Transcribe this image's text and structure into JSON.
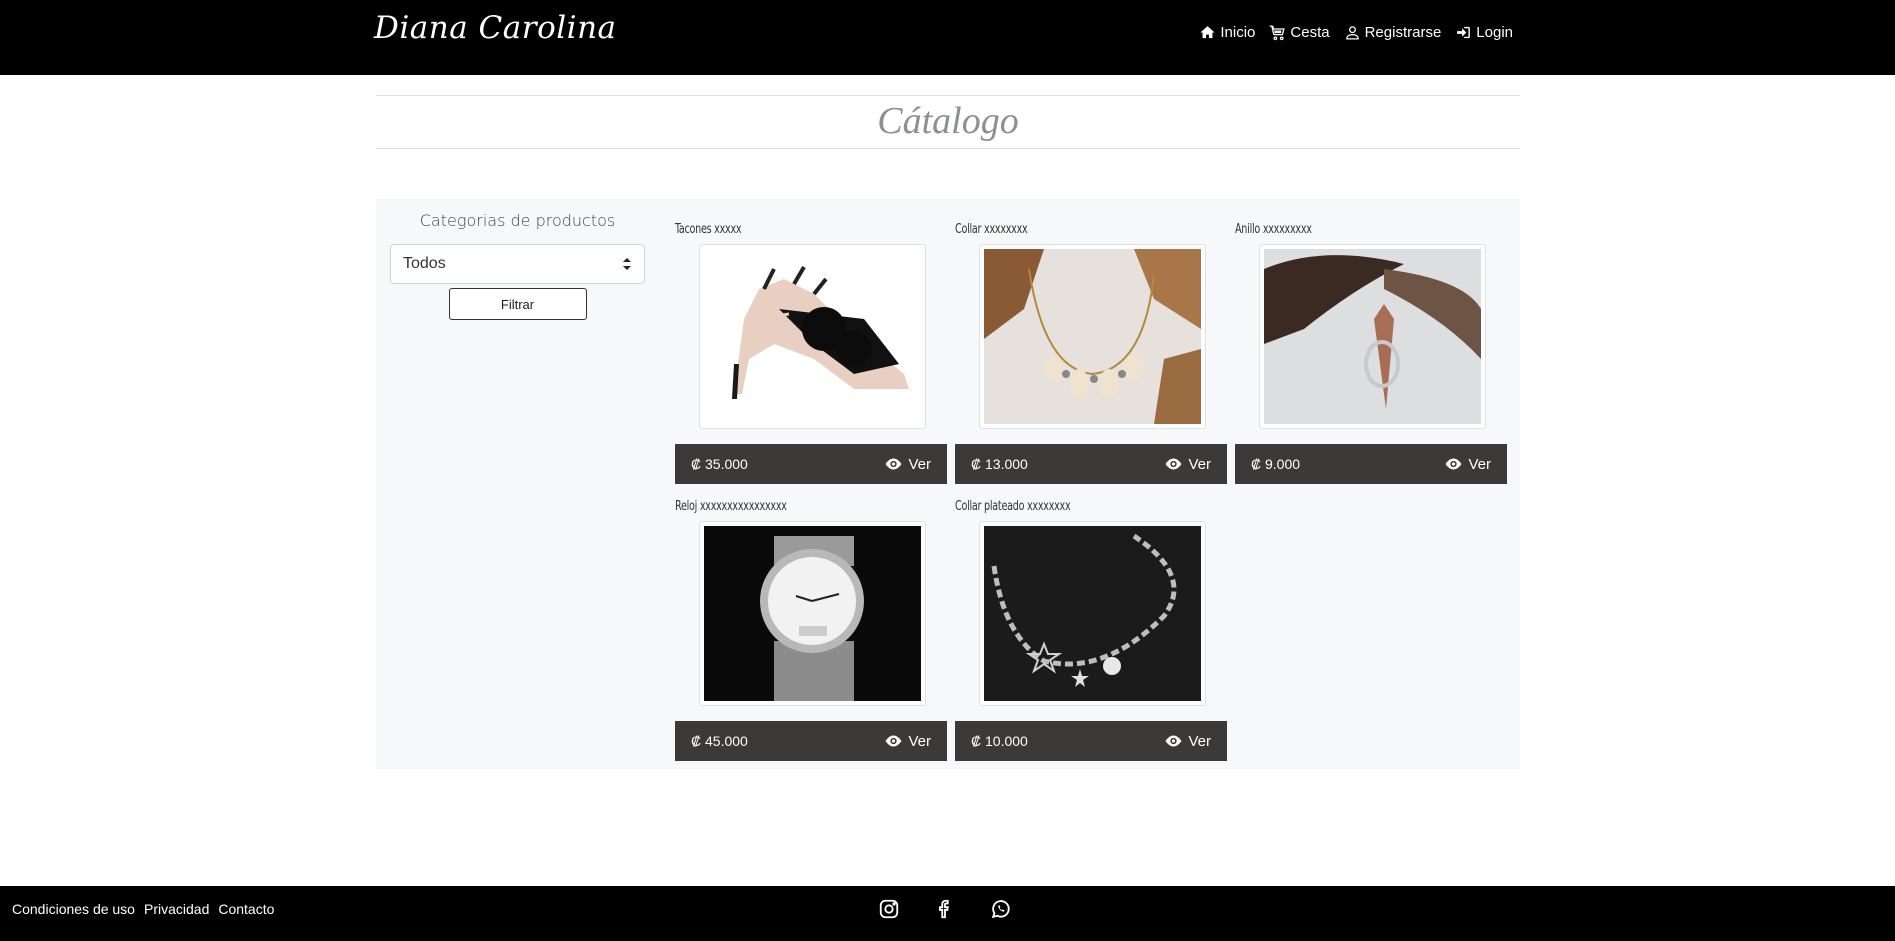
{
  "brand": "Diana Carolina",
  "nav": {
    "inicio": "Inicio",
    "cesta": "Cesta",
    "registrarse": "Registrarse",
    "login": "Login"
  },
  "page_title": "Cátalogo",
  "sidebar": {
    "label": "Categorias de productos",
    "select_value": "Todos",
    "filter_button": "Filtrar"
  },
  "products": [
    {
      "name": "Tacones xxxxx",
      "price": "₡ 35.000",
      "view": "Ver",
      "image": "heels-image"
    },
    {
      "name": "Collar xxxxxxxx",
      "price": "₡ 13.000",
      "view": "Ver",
      "image": "necklace-image"
    },
    {
      "name": "Anillo xxxxxxxxx",
      "price": "₡ 9.000",
      "view": "Ver",
      "image": "ring-image"
    },
    {
      "name": "Reloj xxxxxxxxxxxxxxxx",
      "price": "₡ 45.000",
      "view": "Ver",
      "image": "watch-image"
    },
    {
      "name": "Collar plateado xxxxxxxx",
      "price": "₡ 10.000",
      "view": "Ver",
      "image": "silver-necklace-image"
    }
  ],
  "footer": {
    "links": [
      "Condiciones de uso",
      "Privacidad",
      "Contacto"
    ],
    "social": [
      "instagram-icon",
      "facebook-icon",
      "whatsapp-icon"
    ]
  },
  "colors": {
    "header_bg": "#000000",
    "price_bar": "#3b3a38",
    "panel_bg": "#f7f8fa",
    "title_text": "#8d8f94"
  }
}
